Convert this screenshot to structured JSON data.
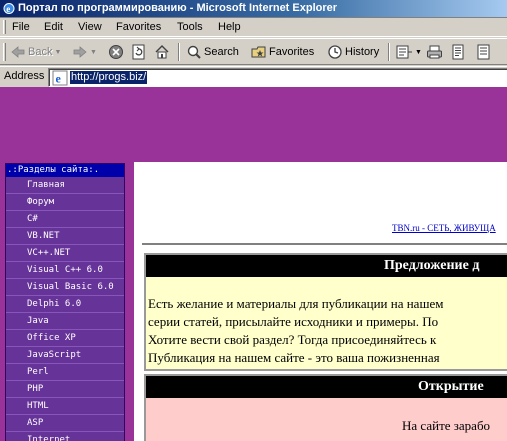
{
  "window": {
    "title": "Портал по программированию - Microsoft Internet Explorer"
  },
  "menu": [
    "File",
    "Edit",
    "View",
    "Favorites",
    "Tools",
    "Help"
  ],
  "toolbar": {
    "back_label": "Back",
    "search_label": "Search",
    "favorites_label": "Favorites",
    "history_label": "History"
  },
  "address": {
    "label": "Address",
    "url": "http://progs.biz/"
  },
  "sidebar": {
    "header": ".:Разделы сайта:.",
    "items": [
      "Главная",
      "Форум",
      "C#",
      "VB.NET",
      "VC++.NET",
      "Visual C++ 6.0",
      "Visual Basic 6.0",
      "Delphi 6.0",
      "Java",
      "Office XP",
      "JavaScript",
      "Perl",
      "PHP",
      "HTML",
      "ASP",
      "Internet"
    ]
  },
  "content": {
    "tbn_link": "TBN.ru - СЕТЬ, ЖИВУЩА",
    "box1": {
      "title": "Предложение д",
      "lines": [
        "Есть желание и материалы для публикации на нашем",
        "серии статей, присылайте исходники и примеры. По",
        "Хотите вести свой раздел? Тогда присоединяйтесь к",
        "Публикация на нашем сайте - это ваша пожизненная"
      ]
    },
    "box2": {
      "title": "Открытие",
      "text": "На сайте зарабо"
    }
  },
  "colors": {
    "banner": "#993399",
    "sidebar": "#663399",
    "sidebar_header": "#0000aa",
    "box1_bg": "#ffffcc",
    "box2_bg": "#ffcccc",
    "selection": "#0a246a"
  }
}
